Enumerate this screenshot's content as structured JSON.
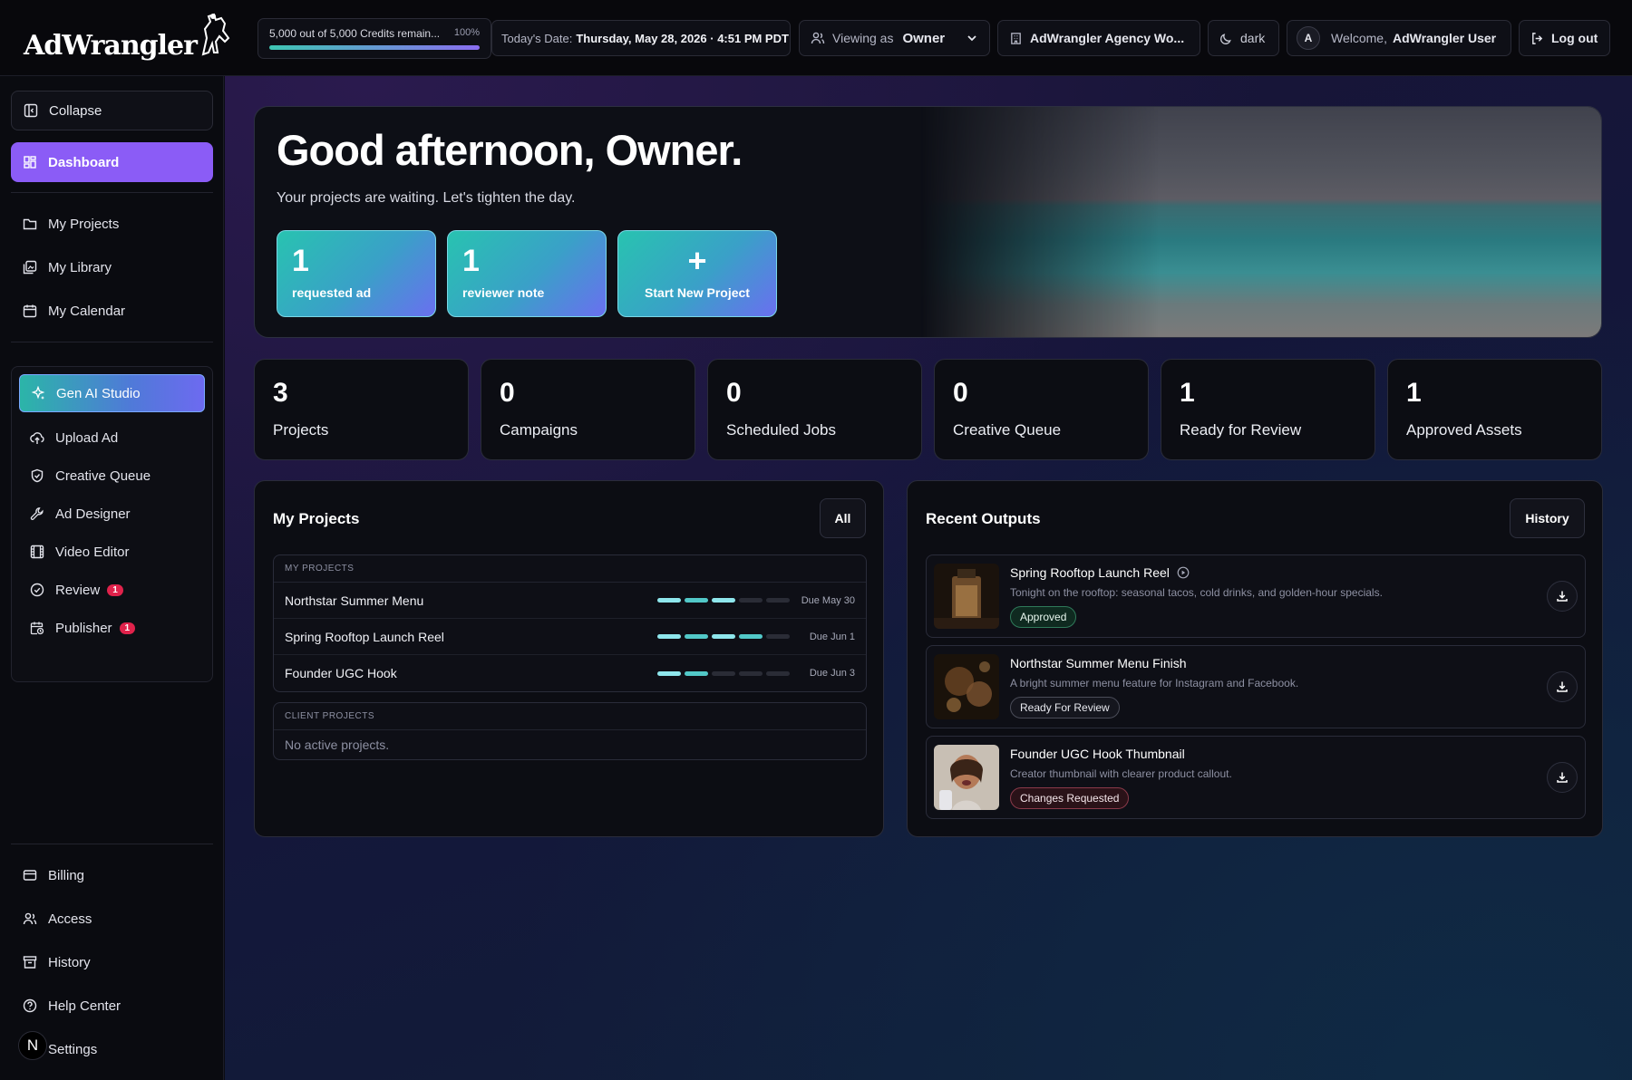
{
  "app": {
    "name": "AdWrangler"
  },
  "topbar": {
    "credits_text": "5,000 out of 5,000 Credits remain...",
    "credits_percent": "100%",
    "credits_fill": 1.0,
    "date_label": "Today's Date:",
    "date_value": "Thursday, May 28, 2026 · 4:51 PM PDT",
    "viewing_label": "Viewing as",
    "viewing_value": "Owner",
    "agency": "AdWrangler Agency Wo...",
    "theme": "dark",
    "avatar_initial": "A",
    "welcome_label": "Welcome,",
    "welcome_name": "AdWrangler User",
    "logout": "Log out"
  },
  "sidebar": {
    "collapse": "Collapse",
    "dashboard": "Dashboard",
    "nav": [
      "My Projects",
      "My Library",
      "My Calendar"
    ],
    "tools": {
      "gen_ai": "Gen AI Studio",
      "upload": "Upload Ad",
      "creative_queue": "Creative Queue",
      "ad_designer": "Ad Designer",
      "video_editor": "Video Editor",
      "review": "Review",
      "review_badge": "1",
      "publisher": "Publisher",
      "publisher_badge": "1"
    },
    "bottom": [
      "Billing",
      "Access",
      "History",
      "Help Center",
      "Settings"
    ],
    "avatar_initial": "N"
  },
  "hero": {
    "title": "Good afternoon, Owner.",
    "subtitle": "Your projects are waiting. Let's tighten the day.",
    "cards": [
      {
        "num": "1",
        "label": "requested ad"
      },
      {
        "num": "1",
        "label": "reviewer note"
      }
    ],
    "new_project": {
      "icon": "+",
      "label": "Start New Project"
    }
  },
  "stats": [
    {
      "num": "3",
      "label": "Projects"
    },
    {
      "num": "0",
      "label": "Campaigns"
    },
    {
      "num": "0",
      "label": "Scheduled Jobs"
    },
    {
      "num": "0",
      "label": "Creative Queue"
    },
    {
      "num": "1",
      "label": "Ready for Review"
    },
    {
      "num": "1",
      "label": "Approved Assets"
    }
  ],
  "my_projects": {
    "title": "My Projects",
    "button": "All",
    "group1": "MY PROJECTS",
    "rows": [
      {
        "name": "Northstar Summer Menu",
        "progress_steps": 3,
        "total_steps": 5,
        "due": "Due May 30"
      },
      {
        "name": "Spring Rooftop Launch Reel",
        "progress_steps": 4,
        "total_steps": 5,
        "due": "Due Jun 1"
      },
      {
        "name": "Founder UGC Hook",
        "progress_steps": 2,
        "total_steps": 5,
        "due": "Due Jun 3"
      }
    ],
    "group2": "CLIENT PROJECTS",
    "empty": "No active projects."
  },
  "recent_outputs": {
    "title": "Recent Outputs",
    "button": "History",
    "items": [
      {
        "title": "Spring Rooftop Launch Reel",
        "desc": "Tonight on the rooftop: seasonal tacos, cold drinks, and golden-hour specials.",
        "status": "Approved",
        "icon": "play-circle-icon"
      },
      {
        "title": "Northstar Summer Menu Finish",
        "desc": "A bright summer menu feature for Instagram and Facebook.",
        "status": "Ready For Review"
      },
      {
        "title": "Founder UGC Hook Thumbnail",
        "desc": "Creator thumbnail with clearer product callout.",
        "status": "Changes Requested"
      }
    ]
  },
  "colors": {
    "accent": "#8b5cf6",
    "teal": "#28c3b0",
    "badge": "#e0224b"
  }
}
